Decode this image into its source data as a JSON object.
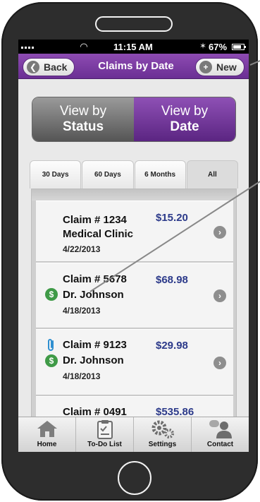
{
  "status_bar": {
    "time": "11:15 AM",
    "battery": "67%"
  },
  "nav": {
    "back_label": "Back",
    "title": "Claims by Date",
    "new_label": "New"
  },
  "view_toggle": {
    "status": {
      "line1": "View by",
      "line2": "Status"
    },
    "date": {
      "line1": "View by",
      "line2": "Date"
    },
    "selected": "date"
  },
  "range_tabs": [
    {
      "label": "30 Days"
    },
    {
      "label": "60 Days"
    },
    {
      "label": "6 Months"
    },
    {
      "label": "All"
    }
  ],
  "claims": [
    {
      "title": "Claim # 1234",
      "name": "Medical Clinic",
      "date": "4/22/2013",
      "amount": "$15.20",
      "icons": []
    },
    {
      "title": "Claim # 5678",
      "name": "Dr. Johnson",
      "date": "4/18/2013",
      "amount": "$68.98",
      "icons": [
        "dollar-icon"
      ]
    },
    {
      "title": "Claim # 9123",
      "name": "Dr. Johnson",
      "date": "4/18/2013",
      "amount": "$29.98",
      "icons": [
        "paperclip-icon",
        "dollar-icon"
      ]
    },
    {
      "title": "Claim # 0491",
      "name": "",
      "date": "",
      "amount": "$535.86",
      "icons": []
    }
  ],
  "tab_bar": [
    {
      "label": "Home",
      "icon": "home-icon"
    },
    {
      "label": "To-Do List",
      "icon": "todo-list-icon"
    },
    {
      "label": "Settings",
      "icon": "gears-icon"
    },
    {
      "label": "Contact",
      "icon": "contact-icon"
    }
  ],
  "colors": {
    "brand_purple": "#6b2f94",
    "amount_blue": "#2c3a8a",
    "dollar_green": "#3f9a47"
  }
}
